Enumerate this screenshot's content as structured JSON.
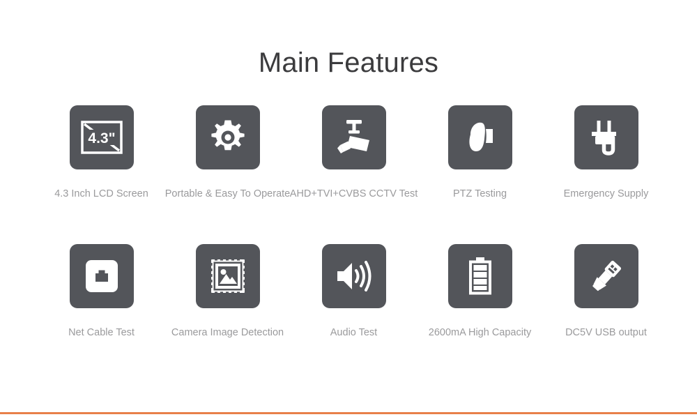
{
  "page": {
    "title": "Main Features",
    "background_color": "#ffffff",
    "title_color": "#3b3b3d",
    "icon_tile_color": "#53555a",
    "icon_glyph_color": "#ffffff",
    "caption_color": "#9a9a9c",
    "accent_rule_color": "#e8804a"
  },
  "features": [
    {
      "row": 1,
      "icon": "lcd-screen-icon",
      "icon_text": "4.3\"",
      "caption": "4.3 Inch LCD Screen"
    },
    {
      "row": 1,
      "icon": "gear-icon",
      "icon_text": "",
      "caption": "Portable & Easy To Operate"
    },
    {
      "row": 1,
      "icon": "cctv-camera-icon",
      "icon_text": "",
      "caption": "AHD+TVI+CVBS CCTV Test"
    },
    {
      "row": 1,
      "icon": "ptz-dome-camera-icon",
      "icon_text": "",
      "caption": "PTZ Testing"
    },
    {
      "row": 1,
      "icon": "power-plug-icon",
      "icon_text": "",
      "caption": "Emergency Supply"
    },
    {
      "row": 2,
      "icon": "ethernet-port-icon",
      "icon_text": "",
      "caption": "Net Cable Test"
    },
    {
      "row": 2,
      "icon": "photo-stamp-icon",
      "icon_text": "",
      "caption": "Camera Image Detection"
    },
    {
      "row": 2,
      "icon": "speaker-audio-icon",
      "icon_text": "",
      "caption": "Audio Test"
    },
    {
      "row": 2,
      "icon": "battery-icon",
      "icon_text": "",
      "caption": "2600mA High Capacity"
    },
    {
      "row": 2,
      "icon": "usb-plug-icon",
      "icon_text": "",
      "caption": "DC5V USB output"
    }
  ]
}
